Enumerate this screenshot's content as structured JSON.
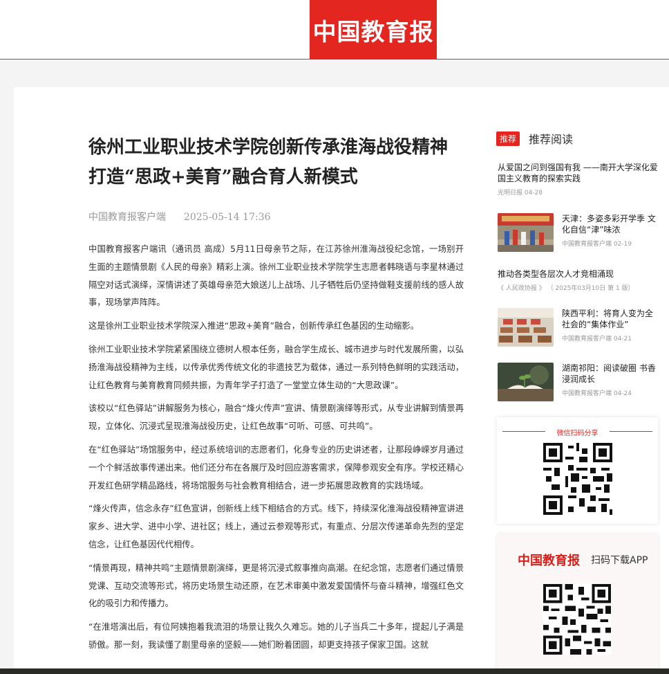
{
  "header": {
    "logo_text": "中国教育报"
  },
  "article": {
    "title": "徐州工业职业技术学院创新传承淮海战役精神 打造“思政+美育”融合育人新模式",
    "source": "中国教育报客户端",
    "date": "2025-05-14 17:36",
    "paragraphs": [
      "中国教育报客户端讯（通讯员 高成）5月11日母亲节之际，在江苏徐州淮海战役纪念馆，一场别开生面的主题情景剧《人民的母亲》精彩上演。徐州工业职业技术学院学生志愿者韩晓语与李星林通过隔空对话式演绎，深情讲述了英雄母亲范大娘送儿上战场、儿子牺牲后仍坚持做鞋支援前线的感人故事，现场掌声阵阵。",
      "这是徐州工业职业技术学院深入推进“思政+美育”融合，创新传承红色基因的生动缩影。",
      "徐州工业职业技术学院紧紧围绕立德树人根本任务，融合学生成长、城市进步与时代发展所需，以弘扬淮海战役精神为主线，以传承优秀传统文化的非遗技艺为载体，通过一系列特色鲜明的实践活动，让红色教育与美育教育同频共振，为青年学子打造了一堂堂立体生动的“大思政课”。",
      "该校以“红色驿站”讲解服务为核心，融合“烽火传声”宣讲、情景剧演绎等形式，从专业讲解到情景再现，立体化、沉浸式呈现淮海战役历史，让红色故事“可听、可感、可共鸣”。",
      "在“红色驿站”场馆服务中，经过系统培训的志愿者们，化身专业的历史讲述者，让那段峥嵘岁月通过一个个鲜活故事传递出来。他们还分布在各展厅及时回应游客需求，保障参观安全有序。学校还精心开发红色研学精品路线，将场馆服务与社会教育相结合，进一步拓展思政教育的实践场域。",
      "“烽火传声，信念永存”红色宣讲，创新线上线下相结合的方式。线下，持续深化淮海战役精神宣讲进家乡、进大学、进中小学、进社区；线上，通过云参观等形式，有重点、分层次传递革命先烈的坚定信念，让红色基因代代相传。",
      "“情景再现，精神共鸣”主题情景剧演绎，更是将沉浸式叙事推向高潮。在纪念馆，志愿者们通过情景党课、互动交流等形式，将历史场景生动还原，在艺术审美中激发爱国情怀与奋斗精神，增强红色文化的吸引力和传播力。",
      "“在淮塔演出后，有位阿姨抱着我流泪的场景让我久久难忘。她的儿子当兵二十多年，提起儿子满是骄傲。那一刻，我读懂了剧里母亲的坚毅——她们盼着团圆，却更支持孩子保家卫国。这就"
    ]
  },
  "sidebar": {
    "badge": "推荐",
    "heading": "推荐阅读",
    "items": [
      {
        "title": "从爱国之问到强国有我 ——南开大学深化爱国主义教育的探索实践",
        "meta": "光明日报  04-28"
      },
      {
        "title": "天津：多姿多彩开学季 文化自信“津”味浓",
        "meta": "中国教育报客户端  02-19"
      },
      {
        "title": "推动各类型各层次人才竞相涌现",
        "meta": "《 人民政协报 》  （ 2025年03月10日 第 1 版）"
      },
      {
        "title": "陕西平利：将育人变为全社会的“集体作业”",
        "meta": "中国教育报客户端  04-21"
      },
      {
        "title": "湖南祁阳：阅读破圈 书香浸润成长",
        "meta": "中国教育报客户端  04-24"
      }
    ],
    "share_label": "微信扫码分享",
    "app_logo": "中国教育报",
    "app_label": "扫码下载APP"
  },
  "colors": {
    "brand_red": "#e3261f"
  },
  "icons": [
    "logo",
    "qr-code-share",
    "qr-code-app"
  ]
}
